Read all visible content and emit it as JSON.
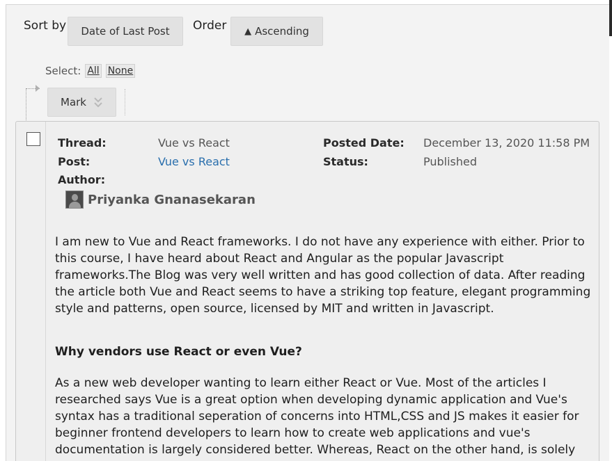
{
  "sort": {
    "label": "Sort by",
    "value": "Date of Last Post",
    "order_label": "Order",
    "order_icon": "▲",
    "order_value": "Ascending"
  },
  "select": {
    "label": "Select:",
    "all": "All",
    "none": "None"
  },
  "mark": {
    "label": "Mark"
  },
  "post": {
    "thread_label": "Thread:",
    "thread_value": "Vue vs React",
    "post_label": "Post:",
    "post_value": "Vue vs React",
    "author_label": "Author:",
    "author_name": "Priyanka Gnanasekaran",
    "posted_date_label": "Posted Date:",
    "posted_date_value": "December 13, 2020 11:58 PM",
    "status_label": "Status:",
    "status_value": "Published",
    "paragraph1": " I am new to Vue and React frameworks. I do not have any experience with either. Prior to this course, I have heard about React and Angular as the popular Javascript frameworks.The Blog was very well written and has good collection of data. After reading the article both Vue and React seems to have a striking top feature, elegant programming style and patterns, open source, licensed by MIT and written in Javascript.",
    "heading": "Why vendors use React or even Vue?",
    "paragraph2": " As a new web developer wanting to learn either React or Vue. Most of the articles I researched says Vue is a great option when developing dynamic application and Vue's syntax has a traditional seperation of concerns into HTML,CSS and JS makes it easier for beginner frontend developers to learn how to create web applications and vue's documentation is largely considered better. Whereas, React on the other hand, is solely JSX while the"
  },
  "colors": {
    "link": "#2a6fad",
    "button_bg": "#e2e2e2",
    "panel_bg": "#f3f3f3"
  }
}
